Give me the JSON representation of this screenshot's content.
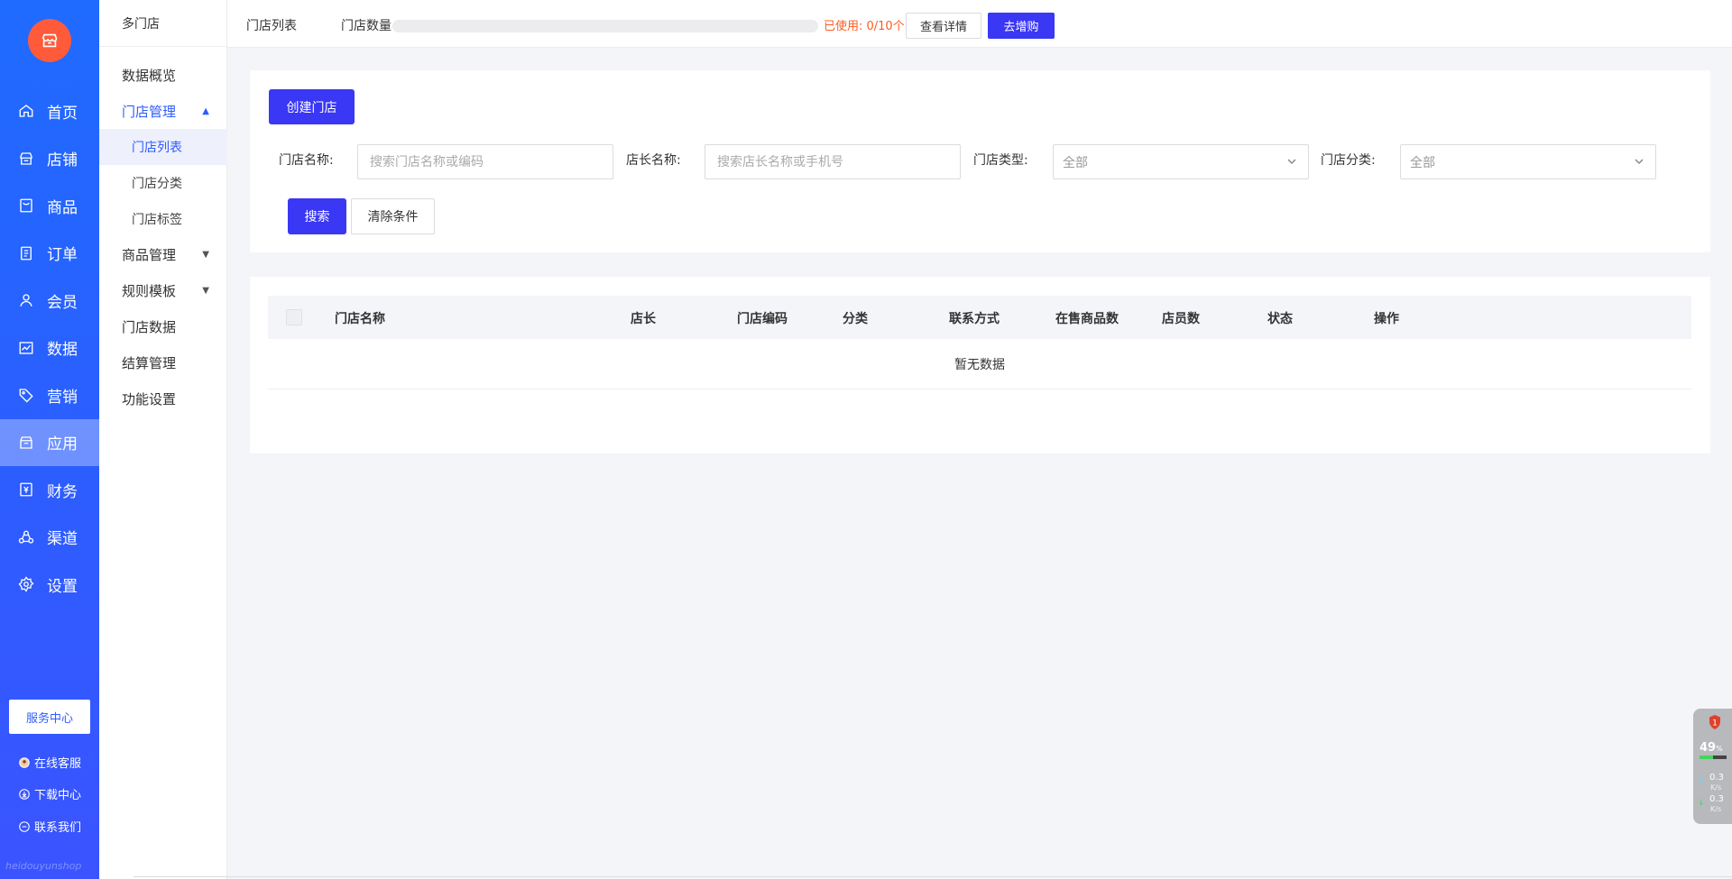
{
  "nav": {
    "logo_icon": "store-icon",
    "items": [
      {
        "label": "首页",
        "icon": "home-icon"
      },
      {
        "label": "店铺",
        "icon": "shop-icon"
      },
      {
        "label": "商品",
        "icon": "goods-icon"
      },
      {
        "label": "订单",
        "icon": "order-icon"
      },
      {
        "label": "会员",
        "icon": "user-icon"
      },
      {
        "label": "数据",
        "icon": "chart-icon"
      },
      {
        "label": "营销",
        "icon": "tag-icon"
      },
      {
        "label": "应用",
        "icon": "app-icon"
      },
      {
        "label": "财务",
        "icon": "finance-icon"
      },
      {
        "label": "渠道",
        "icon": "channel-icon"
      },
      {
        "label": "设置",
        "icon": "gear-icon"
      }
    ],
    "active": "应用",
    "service_center": "服务中心",
    "links": [
      {
        "label": "在线客服",
        "icon": "avatar-icon"
      },
      {
        "label": "下载中心",
        "icon": "download-icon"
      },
      {
        "label": "联系我们",
        "icon": "chat-icon"
      }
    ],
    "watermark": "heidouyunshop"
  },
  "subnav": {
    "title": "多门店",
    "items": [
      {
        "label": "数据概览"
      },
      {
        "label": "门店管理",
        "caret": "▲"
      },
      {
        "label": "门店列表"
      },
      {
        "label": "门店分类"
      },
      {
        "label": "门店标签"
      },
      {
        "label": "商品管理",
        "caret": "▼"
      },
      {
        "label": "规则模板",
        "caret": "▼"
      },
      {
        "label": "门店数据"
      },
      {
        "label": "结算管理"
      },
      {
        "label": "功能设置"
      }
    ]
  },
  "topbar": {
    "crumb": "门店列表",
    "count_label": "门店数量",
    "used_text": "已使用: 0/10个",
    "used_fraction": 0,
    "detail_button": "查看详情",
    "buy_button": "去增购"
  },
  "filter": {
    "create_button": "创建门店",
    "store_name_label": "门店名称:",
    "store_name_placeholder": "搜索门店名称或编码",
    "manager_label": "店长名称:",
    "manager_placeholder": "搜索店长名称或手机号",
    "type_label": "门店类型:",
    "type_value": "全部",
    "category_label": "门店分类:",
    "category_value": "全部",
    "search_button": "搜索",
    "clear_button": "清除条件"
  },
  "table": {
    "columns": [
      "门店名称",
      "店长",
      "门店编码",
      "分类",
      "联系方式",
      "在售商品数",
      "店员数",
      "状态",
      "操作"
    ],
    "empty_text": "暂无数据"
  },
  "widget": {
    "badge": "1",
    "percent": "49",
    "percent_unit": "%",
    "cpu_fraction": 0.49,
    "up_speed": "0.3",
    "down_speed": "0.3",
    "speed_unit": "K/s",
    "accent": "#45d35e"
  },
  "colors": {
    "primary": "#3a37f5",
    "nav_blue": "#1f6bff",
    "warning": "#ff5b1f",
    "logo": "#ff5b3a"
  }
}
